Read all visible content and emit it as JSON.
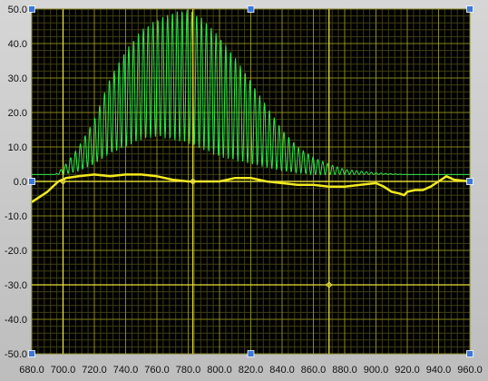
{
  "chart_data": {
    "type": "line",
    "title": "",
    "xlabel": "",
    "ylabel": "",
    "xlim": [
      680,
      960
    ],
    "ylim": [
      -50,
      50
    ],
    "x_ticks": [
      "680.0",
      "700.0",
      "720.0",
      "740.0",
      "760.0",
      "780.0",
      "800.0",
      "820.0",
      "840.0",
      "860.0",
      "880.0",
      "900.0",
      "920.0",
      "940.0",
      "960.0"
    ],
    "y_ticks": [
      "50.0",
      "40.0",
      "30.0",
      "20.0",
      "10.0",
      "0.0",
      "-10.0",
      "-20.0",
      "-30.0",
      "-40.0",
      "-50.0"
    ],
    "grid": true,
    "legend": "none",
    "colors": {
      "plot_background": "#000000",
      "grid_major": "#bdbd2a",
      "grid_minor": "#3f3f12",
      "green_series": "#2ee84a",
      "yellow_series": "#f2ea1e",
      "cursor": "#e8e03a",
      "handle": "#3b78d8"
    },
    "series": [
      {
        "color": "#2ee84a",
        "style": "oscillating envelope",
        "envelope_x": [
          680,
          695,
          700,
          710,
          720,
          730,
          740,
          750,
          760,
          770,
          780,
          790,
          800,
          810,
          820,
          830,
          840,
          850,
          860,
          870,
          880,
          890,
          900,
          920,
          940,
          960
        ],
        "envelope_upper": [
          2,
          2,
          4,
          10,
          18,
          30,
          38,
          44,
          47,
          49,
          50,
          47,
          42,
          36,
          29,
          22,
          15,
          10,
          7,
          5,
          3.5,
          3,
          2.5,
          2,
          2,
          2
        ],
        "envelope_lower": [
          2,
          2,
          2,
          3,
          5,
          8,
          10,
          12,
          13,
          12,
          11,
          9,
          7,
          6,
          5,
          4,
          3,
          2.5,
          2,
          2,
          2,
          2,
          2,
          2,
          2,
          2
        ]
      },
      {
        "color": "#f2ea1e",
        "style": "line",
        "x": [
          680,
          690,
          697,
          702,
          710,
          720,
          730,
          740,
          750,
          760,
          770,
          780,
          790,
          800,
          810,
          820,
          830,
          840,
          850,
          860,
          870,
          880,
          890,
          900,
          905,
          910,
          915,
          918,
          920,
          925,
          930,
          935,
          940,
          945,
          950,
          960
        ],
        "y": [
          -6,
          -3,
          0,
          1,
          1.5,
          2,
          1.5,
          2,
          2,
          1.5,
          0.5,
          0,
          0,
          0,
          1,
          1,
          0,
          -0.5,
          -1,
          -1,
          -1.5,
          -1.5,
          -1,
          -0.5,
          -1.5,
          -3,
          -3.5,
          -4,
          -3,
          -2.5,
          -2.5,
          -1.5,
          0,
          1.5,
          0.5,
          0
        ]
      }
    ],
    "cursors": [
      {
        "x": 700,
        "y": 0
      },
      {
        "x": 783,
        "y": 0
      },
      {
        "x": 870,
        "y": -30
      }
    ]
  }
}
